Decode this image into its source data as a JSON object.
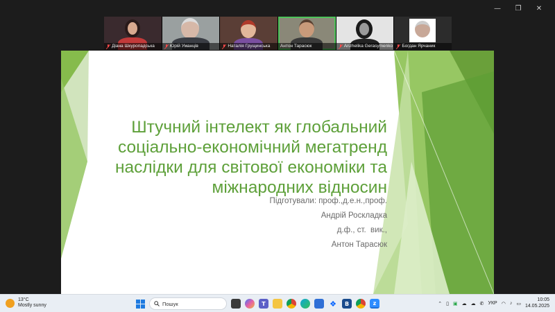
{
  "window": {
    "controls": [
      "—",
      "❐",
      "✕"
    ]
  },
  "participants": [
    {
      "name": "Діана Шкуропадська",
      "muted": true,
      "active": false
    },
    {
      "name": "Юрій Уманців",
      "muted": true,
      "active": false
    },
    {
      "name": "Наталія Грущинська",
      "muted": true,
      "active": false
    },
    {
      "name": "Антон Тарасюк",
      "muted": false,
      "active": true
    },
    {
      "name": "Anzhelika Gerasymenko",
      "muted": true,
      "active": false
    },
    {
      "name": "Богдан Ярчаник",
      "muted": true,
      "active": false
    }
  ],
  "slide": {
    "title_lines": [
      "Штучний інтелект як глобальний",
      "соціально-економічний мегатренд",
      "наслідки для світової економіки та",
      "міжнародних відносин"
    ],
    "subtitle_lines": [
      "Підготували: проф.,д.е.н.,проф.",
      "Андрій Роскладка",
      "д.ф., ст.  вик.,",
      "Антон Тарасюк"
    ],
    "accent_color": "#5ea03a"
  },
  "taskbar": {
    "weather_temp": "13°C",
    "weather_desc": "Mostly sunny",
    "search_placeholder": "Пошук",
    "language": "УКР",
    "time": "10:05",
    "date": "14.05.2025"
  }
}
